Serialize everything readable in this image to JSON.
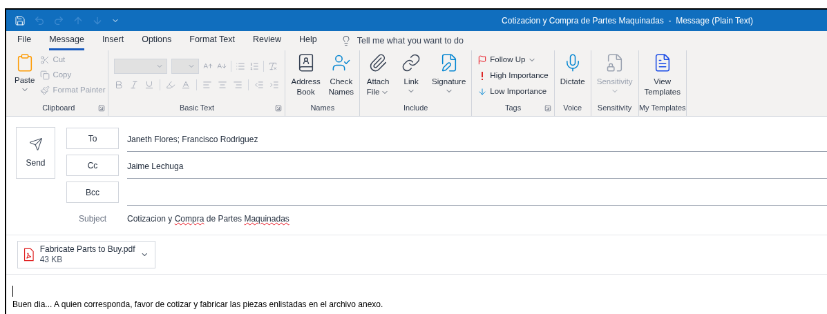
{
  "title_bar": {
    "title": "Cotizacion y Compra de Partes Maquinadas  -  Message (Plain Text)"
  },
  "menu_tabs": [
    {
      "label": "File",
      "selected": false
    },
    {
      "label": "Message",
      "selected": true
    },
    {
      "label": "Insert",
      "selected": false
    },
    {
      "label": "Options",
      "selected": false
    },
    {
      "label": "Format Text",
      "selected": false
    },
    {
      "label": "Review",
      "selected": false
    },
    {
      "label": "Help",
      "selected": false
    }
  ],
  "tell_me": {
    "placeholder": "Tell me what you want to do"
  },
  "ribbon_groups": [
    {
      "kind": "clipboard",
      "label": "Clipboard",
      "launcher": true,
      "items": [
        {
          "lines": [
            "Paste"
          ],
          "dropdown": true,
          "disabled": false
        },
        {
          "lines": [
            "Cut"
          ],
          "dropdown": false,
          "disabled": true
        },
        {
          "lines": [
            "Copy"
          ],
          "dropdown": false,
          "disabled": true
        },
        {
          "lines": [
            "Format Painter"
          ],
          "dropdown": false,
          "disabled": true
        }
      ]
    },
    {
      "kind": "basic_text",
      "label": "Basic Text",
      "launcher": true
    },
    {
      "kind": "large",
      "label": "Names",
      "launcher": false,
      "items": [
        {
          "lines": [
            "Address",
            "Book"
          ],
          "dropdown": false,
          "disabled": false
        },
        {
          "lines": [
            "Check",
            "Names"
          ],
          "dropdown": false,
          "disabled": false
        }
      ]
    },
    {
      "kind": "large",
      "label": "Include",
      "launcher": false,
      "items": [
        {
          "lines": [
            "Attach",
            "File"
          ],
          "dropdown": true,
          "disabled": false
        },
        {
          "lines": [
            "Link"
          ],
          "dropdown": true,
          "disabled": false
        },
        {
          "lines": [
            "Signature"
          ],
          "dropdown": true,
          "disabled": false
        }
      ]
    },
    {
      "kind": "stack",
      "label": "Tags",
      "launcher": true,
      "items": [
        {
          "lines": [
            "Follow Up"
          ],
          "dropdown": true,
          "disabled": false
        },
        {
          "lines": [
            "High Importance"
          ],
          "dropdown": false,
          "disabled": false
        },
        {
          "lines": [
            "Low Importance"
          ],
          "dropdown": false,
          "disabled": false
        }
      ]
    },
    {
      "kind": "large",
      "label": "Voice",
      "launcher": false,
      "items": [
        {
          "lines": [
            "Dictate"
          ],
          "dropdown": false,
          "disabled": false
        }
      ]
    },
    {
      "kind": "large",
      "label": "Sensitivity",
      "launcher": false,
      "items": [
        {
          "lines": [
            "Sensitivity"
          ],
          "dropdown": true,
          "disabled": true
        }
      ]
    },
    {
      "kind": "large",
      "label": "My Templates",
      "launcher": false,
      "items": [
        {
          "lines": [
            "View",
            "Templates"
          ],
          "dropdown": false,
          "disabled": false
        }
      ]
    }
  ],
  "send_button": {
    "label": "Send"
  },
  "recipients": [
    {
      "label": "To",
      "value": "Janeth Flores; Francisco Rodriguez"
    },
    {
      "label": "Cc",
      "value": "Jaime Lechuga"
    },
    {
      "label": "Bcc"
    }
  ],
  "subject": {
    "label": "Subject",
    "segments": [
      {
        "text": "Cotizacion y ",
        "misspelled": false
      },
      {
        "text": "Compra",
        "misspelled": true
      },
      {
        "text": " de ",
        "misspelled": false
      },
      {
        "text": "Partes ",
        "misspelled": false
      },
      {
        "text": "Maquinadas",
        "misspelled": true
      }
    ]
  },
  "attachment": {
    "name": "Fabricate Parts to Buy.pdf",
    "size": "43 KB"
  },
  "body": {
    "cursor": true,
    "text": "Buen dia... A quien corresponda, favor de cotizar y fabricar las piezas enlistadas en el archivo anexo."
  }
}
